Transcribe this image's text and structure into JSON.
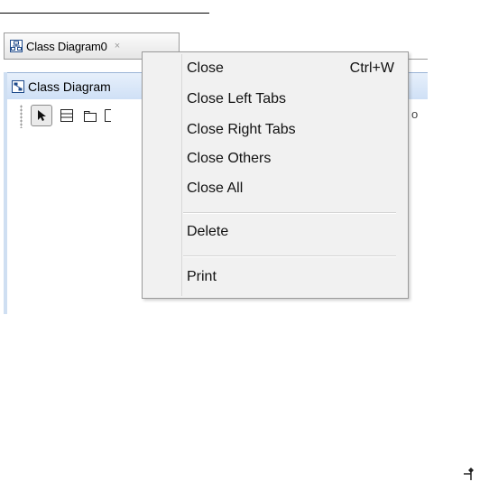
{
  "tab": {
    "label": "Class Diagram0",
    "close_glyph": "×",
    "icon": "class-diagram-icon"
  },
  "panel": {
    "title": "Class Diagram",
    "icon": "diagram-panel-icon"
  },
  "toolbar": {
    "tools": [
      "select-arrow-icon",
      "class-tool-icon",
      "package-tool-icon",
      "note-tool-icon"
    ],
    "peek_glyph": "o"
  },
  "context_menu": {
    "items": [
      {
        "label": "Close",
        "shortcut": "Ctrl+W"
      },
      {
        "label": "Close Left Tabs",
        "shortcut": ""
      },
      {
        "label": "Close Right Tabs",
        "shortcut": ""
      },
      {
        "label": "Close Others",
        "shortcut": ""
      },
      {
        "label": "Close All",
        "shortcut": ""
      },
      {
        "label": "Delete",
        "shortcut": ""
      },
      {
        "label": "Print",
        "shortcut": ""
      }
    ]
  },
  "corner": {
    "icon": "dock-pin-icon"
  },
  "colors": {
    "panel_header": "#cfe0f6",
    "menu_background": "#f1f1f1",
    "accent": "#1f4a8a"
  }
}
